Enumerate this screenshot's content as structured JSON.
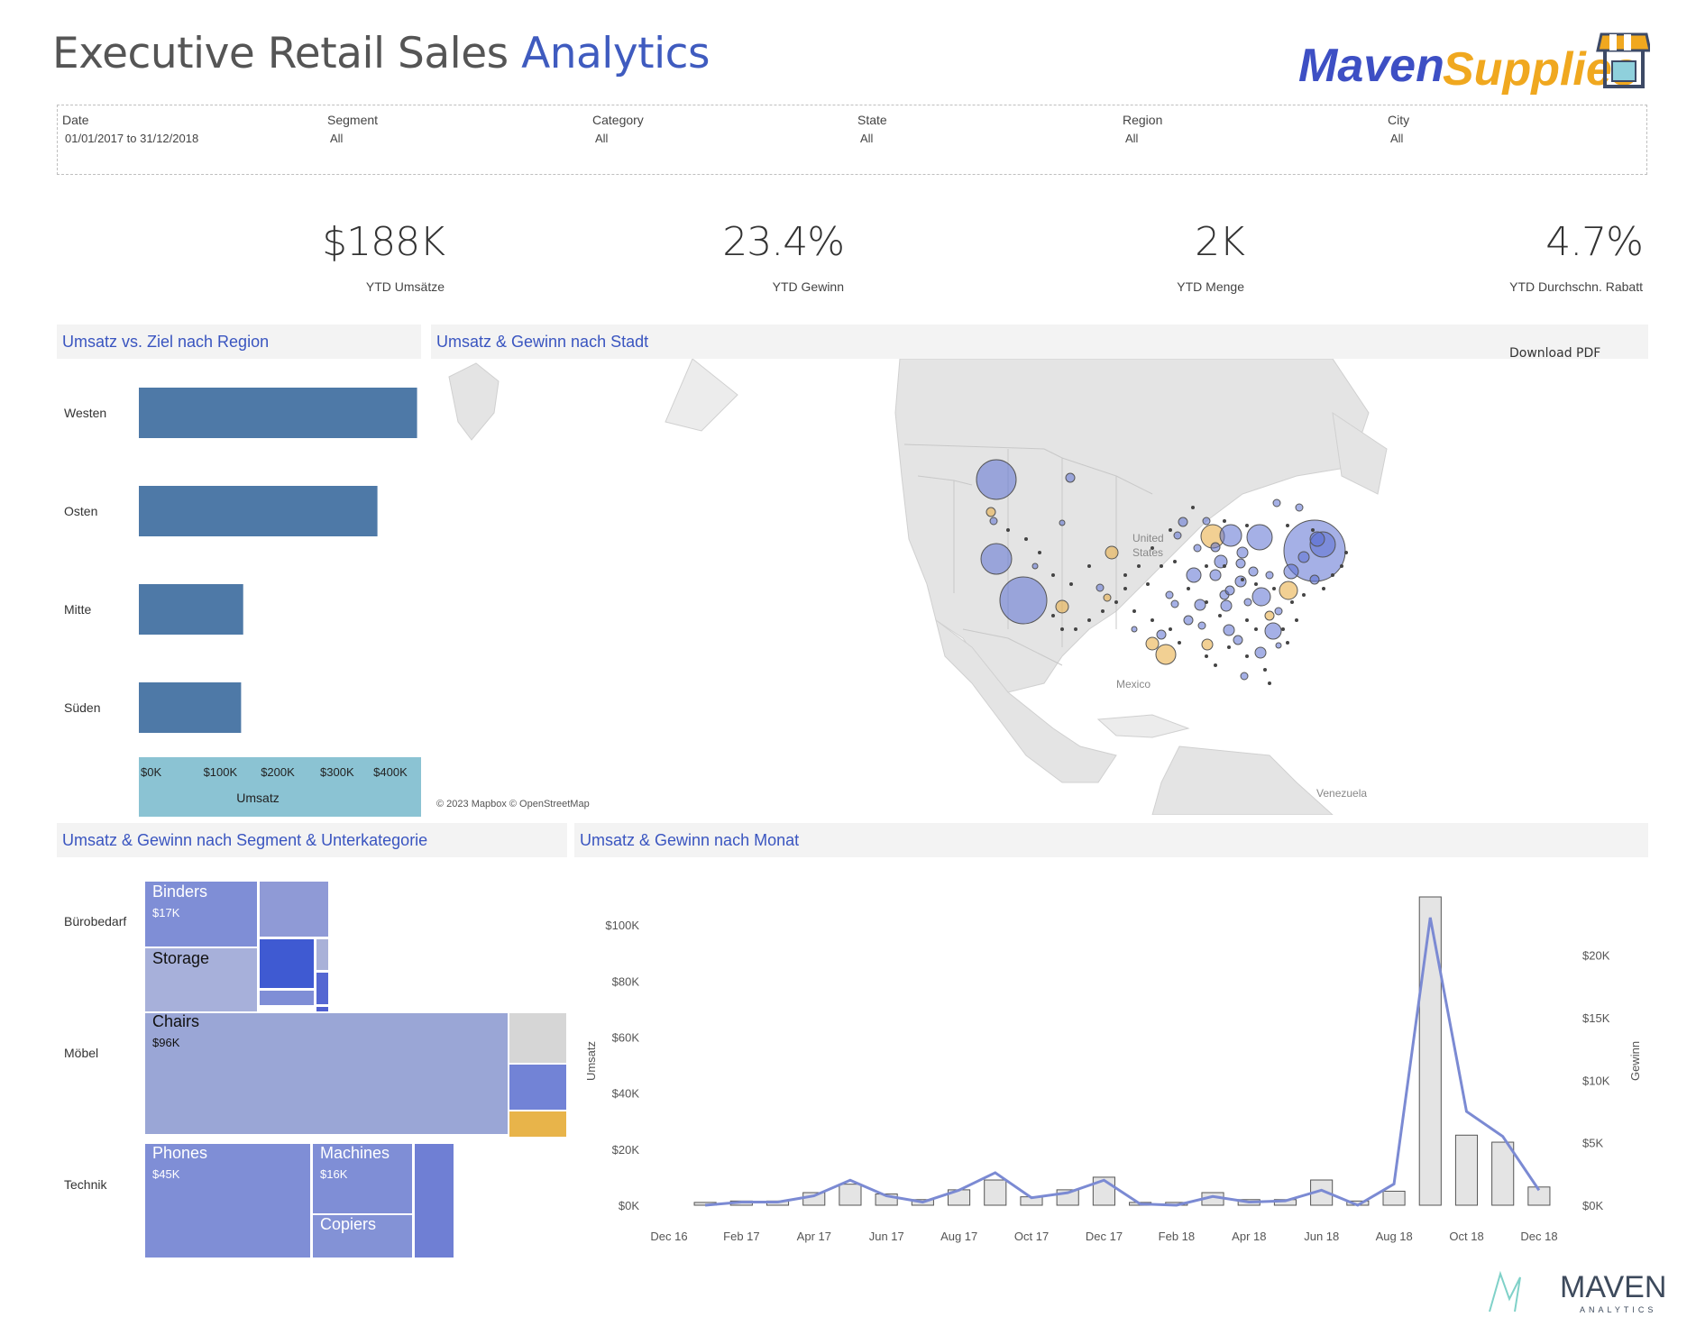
{
  "header": {
    "title_main": "Executive Retail Sales ",
    "title_accent": "Analytics",
    "logo_text_1": "Maven",
    "logo_text_2": "Supplies"
  },
  "filters": [
    {
      "label": "Date",
      "value": "01/01/2017 to 31/12/2018"
    },
    {
      "label": "Segment",
      "value": "All"
    },
    {
      "label": "Category",
      "value": "All"
    },
    {
      "label": "State",
      "value": "All"
    },
    {
      "label": "Region",
      "value": "All"
    },
    {
      "label": "City",
      "value": "All"
    }
  ],
  "kpis": [
    {
      "value": "$188K",
      "label": "YTD Umsätze"
    },
    {
      "value": "23.4%",
      "label": "YTD Gewinn"
    },
    {
      "value": "2K",
      "label": "YTD Menge"
    },
    {
      "value": "4.7%",
      "label": "YTD Durchschn. Rabatt"
    }
  ],
  "panels": {
    "region": "Umsatz vs. Ziel nach Region",
    "map": "Umsatz & Gewinn nach Stadt",
    "segment": "Umsatz & Gewinn nach Segment & Unterkategorie",
    "month": "Umsatz & Gewinn nach Monat"
  },
  "map": {
    "download": "Download PDF",
    "attribution": "© 2023 Mapbox © OpenStreetMap",
    "labels": [
      "United",
      "States",
      "Mexico",
      "Venezuela"
    ],
    "colors": {
      "profit": "#5b6fd1",
      "loss": "#e8a93a",
      "land": "#e6e6e6"
    }
  },
  "chart_data": [
    {
      "type": "bar",
      "orientation": "horizontal",
      "categories": [
        "Westen",
        "Osten",
        "Mitte",
        "Süden"
      ],
      "values": [
        400000,
        343000,
        150000,
        147000
      ],
      "xlabel": "Umsatz",
      "xticks": [
        "$0K",
        "$100K",
        "$200K",
        "$300K",
        "$400K"
      ],
      "xlim": [
        0,
        420000
      ],
      "color": "#4e79a7"
    },
    {
      "type": "treemap",
      "segments": [
        "Bürobedarf",
        "Möbel",
        "Technik"
      ],
      "labeled_items": [
        {
          "segment": "Bürobedarf",
          "name": "Binders",
          "value_label": "$17K"
        },
        {
          "segment": "Bürobedarf",
          "name": "Storage",
          "value_label": ""
        },
        {
          "segment": "Möbel",
          "name": "Chairs",
          "value_label": "$96K"
        },
        {
          "segment": "Technik",
          "name": "Phones",
          "value_label": "$45K"
        },
        {
          "segment": "Technik",
          "name": "Machines",
          "value_label": "$16K"
        },
        {
          "segment": "Technik",
          "name": "Copiers",
          "value_label": ""
        }
      ]
    },
    {
      "type": "bar+line",
      "x": [
        "Dec 16",
        "Jan 17",
        "Feb 17",
        "Mar 17",
        "Apr 17",
        "May 17",
        "Jun 17",
        "Jul 17",
        "Aug 17",
        "Sep 17",
        "Oct 17",
        "Nov 17",
        "Dec 17",
        "Jan 18",
        "Feb 18",
        "Mar 18",
        "Apr 18",
        "May 18",
        "Jun 18",
        "Jul 18",
        "Aug 18",
        "Sep 18",
        "Oct 18",
        "Nov 18",
        "Dec 18"
      ],
      "xticks": [
        "Dec 16",
        "Feb 17",
        "Apr 17",
        "Jun 17",
        "Aug 17",
        "Oct 17",
        "Dec 17",
        "Feb 18",
        "Apr 18",
        "Jun 18",
        "Aug 18",
        "Oct 18",
        "Dec 18"
      ],
      "series": [
        {
          "name": "Umsatz",
          "type": "bar",
          "axis": "left",
          "values": [
            1000,
            1500,
            1500,
            4500,
            7500,
            4000,
            2000,
            5500,
            9000,
            3000,
            5500,
            10000,
            1000,
            1000,
            4500,
            2000,
            2000,
            9000,
            1500,
            5000,
            110000,
            25000,
            22500,
            6500
          ]
        },
        {
          "name": "Gewinn",
          "type": "line",
          "axis": "right",
          "values": [
            0,
            250,
            250,
            750,
            2000,
            750,
            250,
            1200,
            2600,
            600,
            1000,
            2000,
            100,
            0,
            700,
            250,
            350,
            1200,
            0,
            1700,
            23000,
            7500,
            5500,
            1200
          ]
        }
      ],
      "ylabel": "Umsatz",
      "y2label": "Gewinn",
      "ylim": [
        0,
        110000
      ],
      "y2lim": [
        0,
        23500
      ],
      "yticks": [
        "$0K",
        "$20K",
        "$40K",
        "$60K",
        "$80K",
        "$100K"
      ],
      "y2ticks": [
        "$0K",
        "$5K",
        "$10K",
        "$15K",
        "$20K"
      ]
    }
  ],
  "footer": {
    "brand": "MAVEN",
    "sub": "ANALYTICS"
  }
}
